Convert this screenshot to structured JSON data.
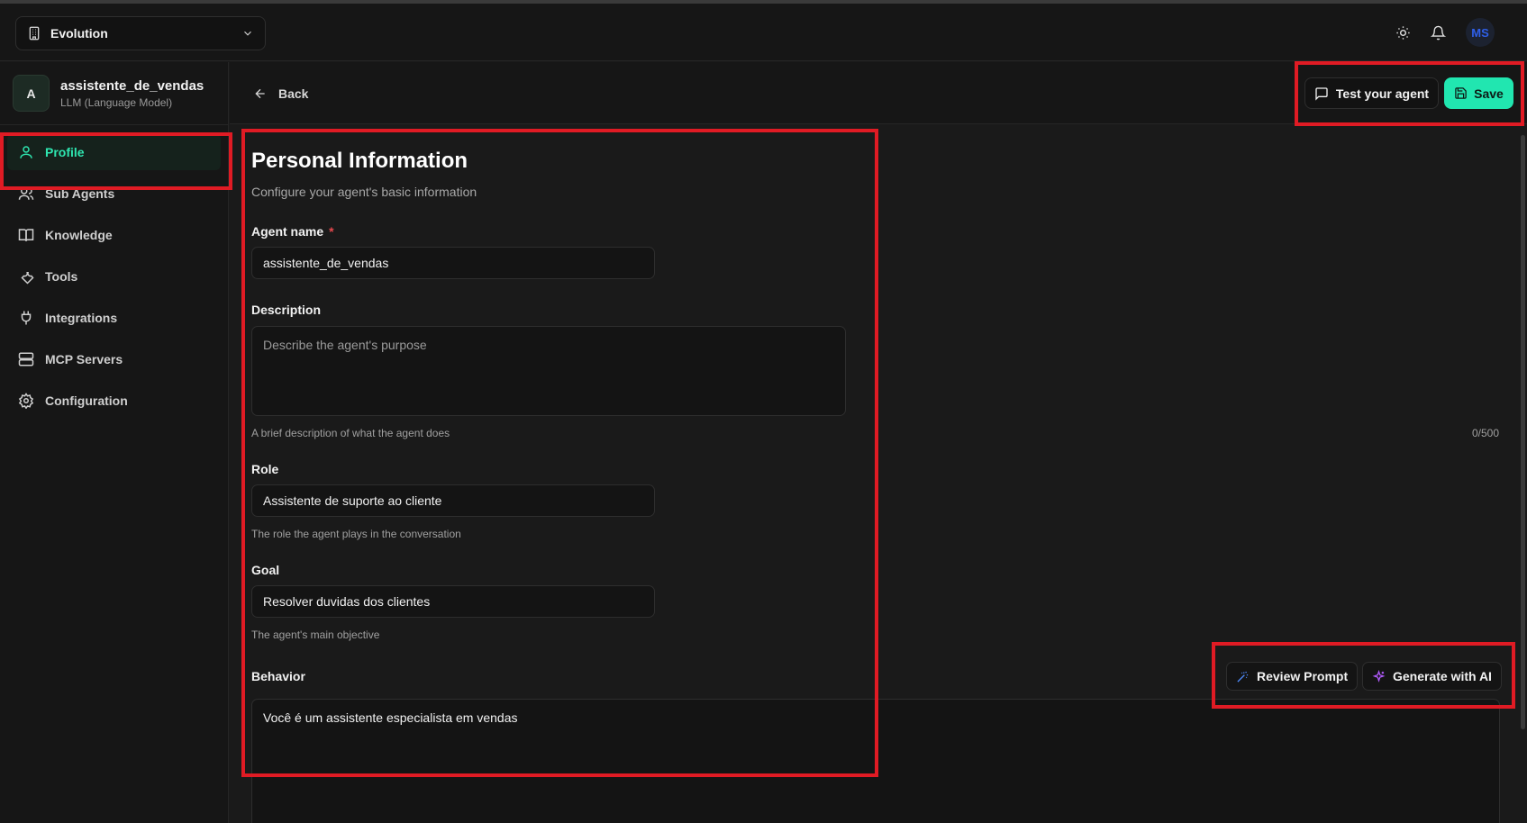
{
  "workspace": {
    "name": "Evolution"
  },
  "topbar": {
    "avatar_initials": "MS"
  },
  "agent": {
    "initial": "A",
    "name": "assistente_de_vendas",
    "type": "LLM (Language Model)"
  },
  "nav": {
    "items": [
      {
        "label": "Profile",
        "icon": "user-icon"
      },
      {
        "label": "Sub Agents",
        "icon": "users-icon"
      },
      {
        "label": "Knowledge",
        "icon": "book-icon"
      },
      {
        "label": "Tools",
        "icon": "wrench-icon"
      },
      {
        "label": "Integrations",
        "icon": "plug-icon"
      },
      {
        "label": "MCP Servers",
        "icon": "server-icon"
      },
      {
        "label": "Configuration",
        "icon": "gear-icon"
      }
    ]
  },
  "header": {
    "back_label": "Back",
    "test_label": "Test your agent",
    "save_label": "Save"
  },
  "form": {
    "title": "Personal Information",
    "subtitle": "Configure your agent's basic information",
    "agent_name": {
      "label": "Agent name",
      "required_mark": "*",
      "value": "assistente_de_vendas"
    },
    "description": {
      "label": "Description",
      "placeholder": "Describe the agent's purpose",
      "value": "",
      "hint": "A brief description of what the agent does",
      "counter": "0/500"
    },
    "role": {
      "label": "Role",
      "value": "Assistente de suporte ao cliente",
      "hint": "The role the agent plays in the conversation"
    },
    "goal": {
      "label": "Goal",
      "value": "Resolver duvidas dos clientes",
      "hint": "The agent's main objective"
    },
    "behavior": {
      "label": "Behavior",
      "value": "Você é um assistente especialista em vendas",
      "review_label": "Review Prompt",
      "generate_label": "Generate with AI"
    }
  },
  "colors": {
    "accent": "#21e6b0",
    "highlight": "#e01b24",
    "background": "#1a1a1a"
  }
}
